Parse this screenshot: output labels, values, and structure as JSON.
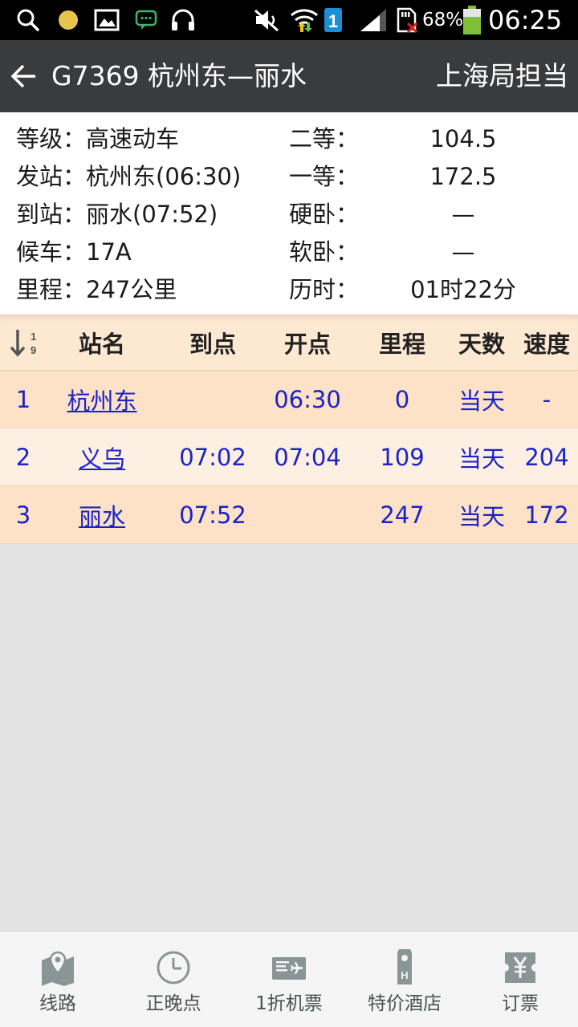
{
  "status_bar": {
    "battery_percent": "68%",
    "time": "06:25",
    "sim_badge": "1",
    "icons": [
      "search-icon",
      "notification-dot-icon",
      "gallery-icon",
      "chat-icon",
      "headset-icon",
      "vibrate-off-icon",
      "wifi-icon",
      "sim-1-icon",
      "signal-icon",
      "sd-card-icon",
      "battery-icon"
    ]
  },
  "header": {
    "title": "G7369 杭州东—丽水",
    "bureau": "上海局担当"
  },
  "info": {
    "left": [
      "等级：高速动车",
      "发站：杭州东(06:30)",
      "到站：丽水(07:52)",
      "候车：17A",
      "里程：247公里"
    ],
    "right_labels": [
      "二等：",
      "一等：",
      "硬卧：",
      "软卧：",
      "历时："
    ],
    "right_values": [
      "104.5",
      "172.5",
      "—",
      "—",
      "01时22分"
    ]
  },
  "table": {
    "headers": {
      "station": "站名",
      "arrive": "到点",
      "depart": "开点",
      "mileage": "里程",
      "days": "天数",
      "speed": "速度"
    },
    "rows": [
      {
        "idx": "1",
        "station": "杭州东",
        "arrive": "",
        "depart": "06:30",
        "mileage": "0",
        "days": "当天",
        "speed": "-"
      },
      {
        "idx": "2",
        "station": "义乌",
        "arrive": "07:02",
        "depart": "07:04",
        "mileage": "109",
        "days": "当天",
        "speed": "204"
      },
      {
        "idx": "3",
        "station": "丽水",
        "arrive": "07:52",
        "depart": "",
        "mileage": "247",
        "days": "当天",
        "speed": "172"
      }
    ]
  },
  "bottom_nav": [
    {
      "label": "线路",
      "icon": "map-pin-icon"
    },
    {
      "label": "正晚点",
      "icon": "clock-icon"
    },
    {
      "label": "1折机票",
      "icon": "flight-ticket-icon"
    },
    {
      "label": "特价酒店",
      "icon": "hotel-tag-icon"
    },
    {
      "label": "订票",
      "icon": "yen-ticket-icon"
    }
  ],
  "colors": {
    "header_bg": "#3a3b3d",
    "row_odd": "#fde2c8",
    "row_even": "#fdefe2",
    "link_blue": "#1a23c8",
    "nav_icon": "#8a9596"
  }
}
